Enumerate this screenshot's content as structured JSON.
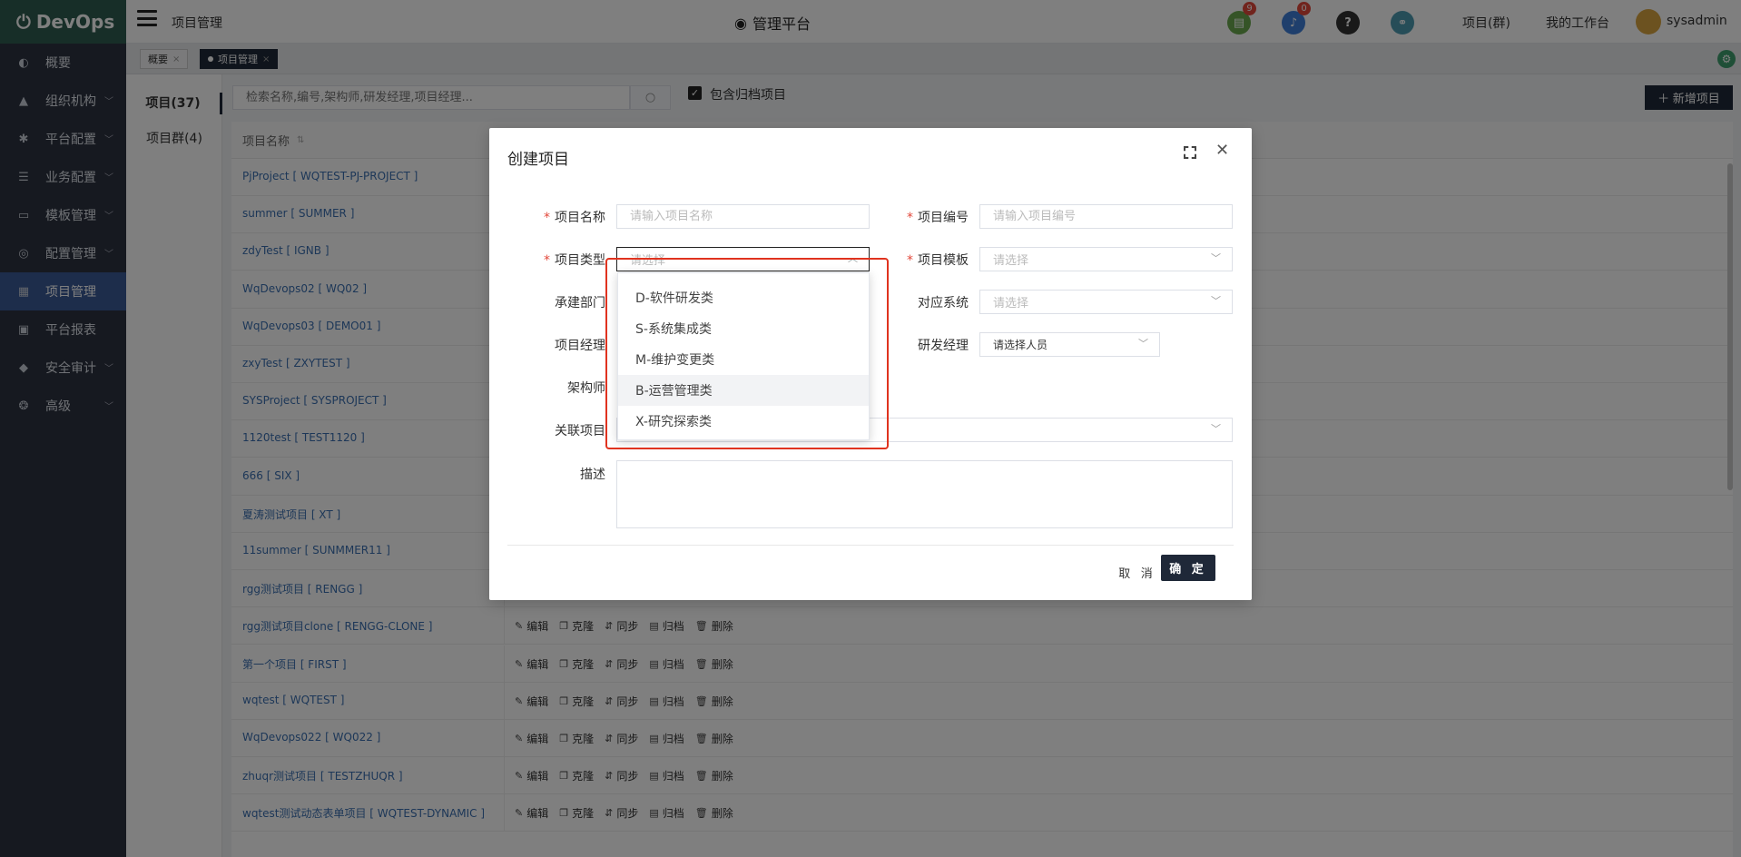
{
  "brand": {
    "name": "DevOps"
  },
  "sidebar": {
    "items": [
      {
        "label": "概要",
        "icon": "dashboard-icon",
        "has_children": false
      },
      {
        "label": "组织机构",
        "icon": "lock-icon",
        "has_children": true
      },
      {
        "label": "平台配置",
        "icon": "gear-icon",
        "has_children": true
      },
      {
        "label": "业务配置",
        "icon": "sliders-icon",
        "has_children": true
      },
      {
        "label": "模板管理",
        "icon": "template-icon",
        "has_children": true
      },
      {
        "label": "配置管理",
        "icon": "database-icon",
        "has_children": true
      },
      {
        "label": "项目管理",
        "icon": "grid-icon",
        "has_children": false,
        "active": true
      },
      {
        "label": "平台报表",
        "icon": "monitor-icon",
        "has_children": false
      },
      {
        "label": "安全审计",
        "icon": "shield-icon",
        "has_children": true
      },
      {
        "label": "高级",
        "icon": "cogs-icon",
        "has_children": true
      }
    ]
  },
  "header": {
    "breadcrumb": "项目管理",
    "page_title": "管理平台",
    "todo_badge": "9",
    "notify_badge": "0",
    "links": [
      "项目(群)",
      "我的工作台"
    ],
    "username": "sysadmin"
  },
  "tabs": [
    {
      "label": "概要",
      "active": false
    },
    {
      "label": "项目管理",
      "active": true
    }
  ],
  "left_nav": {
    "projects": "项目(37)",
    "groups": "项目群(4)"
  },
  "toolbar": {
    "search_placeholder": "检索名称,编号,架构师,研发经理,项目经理...",
    "include_archived_label": "包含归档项目",
    "include_archived_checked": true,
    "new_button": "新增项目"
  },
  "table": {
    "header": "项目名称",
    "actions": [
      "编辑",
      "克隆",
      "同步",
      "归档",
      "删除"
    ],
    "rows": [
      "PjProject [ WQTEST-PJ-PROJECT ]",
      "summer [ SUMMER ]",
      "zdyTest [ IGNB ]",
      "WqDevops02 [ WQ02 ]",
      "WqDevops03 [ DEMO01 ]",
      "zxyTest [ ZXYTEST ]",
      "SYSProject [ SYSPROJECT ]",
      "1120test [ TEST1120 ]",
      "666 [ SIX ]",
      "夏涛测试项目 [ XT ]",
      "11summer [ SUNMMER11 ]",
      "rgg测试项目 [ RENGG ]",
      "rgg测试项目clone [ RENGG-CLONE ]",
      "第一个项目 [ FIRST ]",
      "wqtest [ WQTEST ]",
      "WqDevops022 [ WQ022 ]",
      "zhuqr测试项目 [ TESTZHUQR ]",
      "wqtest测试动态表单项目 [ WQTEST-DYNAMIC ]"
    ]
  },
  "modal": {
    "title": "创建项目",
    "fields": {
      "name_label": "项目名称",
      "name_placeholder": "请输入项目名称",
      "code_label": "项目编号",
      "code_placeholder": "请输入项目编号",
      "type_label": "项目类型",
      "type_placeholder": "请选择",
      "template_label": "项目模板",
      "template_placeholder": "请选择",
      "dept_label": "承建部门",
      "system_label": "对应系统",
      "system_placeholder": "请选择",
      "pm_label": "项目经理",
      "rd_label": "研发经理",
      "rd_value": "请选择人员",
      "architect_label": "架构师",
      "related_label": "关联项目",
      "desc_label": "描述"
    },
    "dropdown_options": [
      "D-软件研发类",
      "S-系统集成类",
      "M-维护变更类",
      "B-运营管理类",
      "X-研究探索类"
    ],
    "hovered_option": "B-运营管理类",
    "cancel": "取 消",
    "confirm": "确 定"
  },
  "colors": {
    "sidebar_bg": "#2c3340",
    "logo_bg": "#2f5d50",
    "active_menu": "#3b5a96",
    "primary_dark": "#1f2838",
    "highlight_box": "#e0331f"
  }
}
